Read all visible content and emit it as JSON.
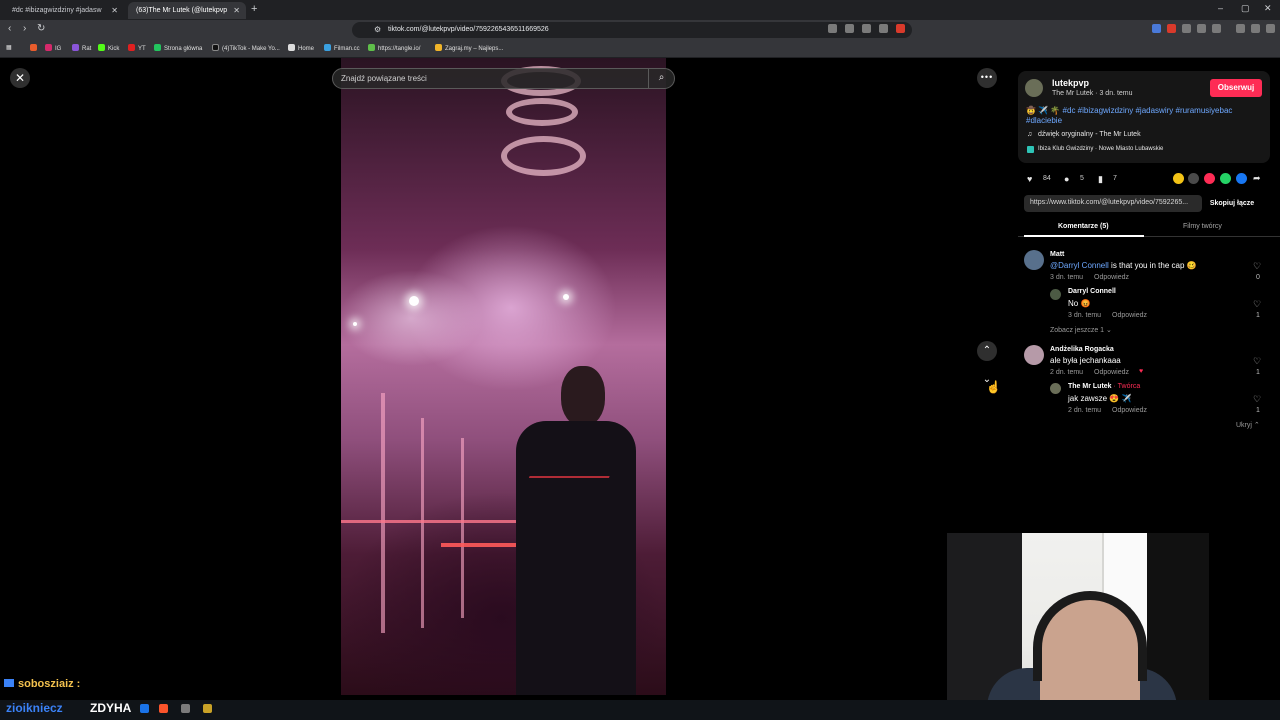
{
  "browser": {
    "tabs": [
      {
        "label": "#dc #ibizagwizdziny #jadasw"
      },
      {
        "label": "(63)The Mr Lutek (@lutekpvp"
      }
    ],
    "url": "tiktok.com/@lutekpvp/video/7592265436511669526",
    "bookmarks": [
      "IG",
      "Rat",
      "Kick",
      "YT",
      "Strona główna",
      "(4)TikTok - Make Yo...",
      "Home",
      "Filman.cc",
      "https://tangle.io/",
      "Zagraj.my – Najleps..."
    ]
  },
  "search": {
    "placeholder": "Znajdź powiązane treści"
  },
  "post": {
    "username": "lutekpvp",
    "subtitle": "The Mr Lutek · 3 dn. temu",
    "follow_label": "Obserwuj",
    "hashtags": "🤠 ✈️ 🌴 #dc #ibizagwizdziny #jadaswiry #ruramusiyebac #dlaciebie",
    "sound": "dźwięk oryginalny - The Mr Lutek",
    "location": "Ibiza Klub Gwizdziny · Nowe Miasto Lubawskie",
    "likes": "84",
    "comments": "5",
    "saves": "7",
    "link": "https://www.tiktok.com/@lutekpvp/video/7592265...",
    "copy_label": "Skopiuj łącze",
    "tab_comments": "Komentarze (5)",
    "tab_creator": "Filmy twórcy"
  },
  "comments": [
    {
      "user": "Matt",
      "mention": "@Darryl Connell",
      "text": " is that you in the cap 🥴",
      "time": "3 dn. temu",
      "reply": "Odpowiedz",
      "likes": "0"
    },
    {
      "user": "Darryl Connell",
      "text": "No 😡",
      "time": "3 dn. temu",
      "reply": "Odpowiedz",
      "likes": "1"
    },
    {
      "more": "Zobacz jeszcze 1 ⌄"
    },
    {
      "user": "Andżelika Rogacka",
      "text": "ale była jechankaaa",
      "time": "2 dn. temu",
      "reply": "Odpowiedz",
      "likes": "1"
    },
    {
      "user": "The Mr Lutek",
      "creator": " · Twórca",
      "text": "jak zawsze 😍 ✈️",
      "time": "2 dn. temu",
      "reply": "Odpowiedz",
      "likes": "1"
    }
  ],
  "hide_label": "Ukryj ⌃",
  "chat": {
    "user": "sobosziaiz :",
    "line2": "zioikniecz",
    "line2b": "ZDYHA"
  },
  "colors": {
    "accent": "#fe2c55",
    "link": "#6ea8ff",
    "creator": "#fe2c55"
  }
}
